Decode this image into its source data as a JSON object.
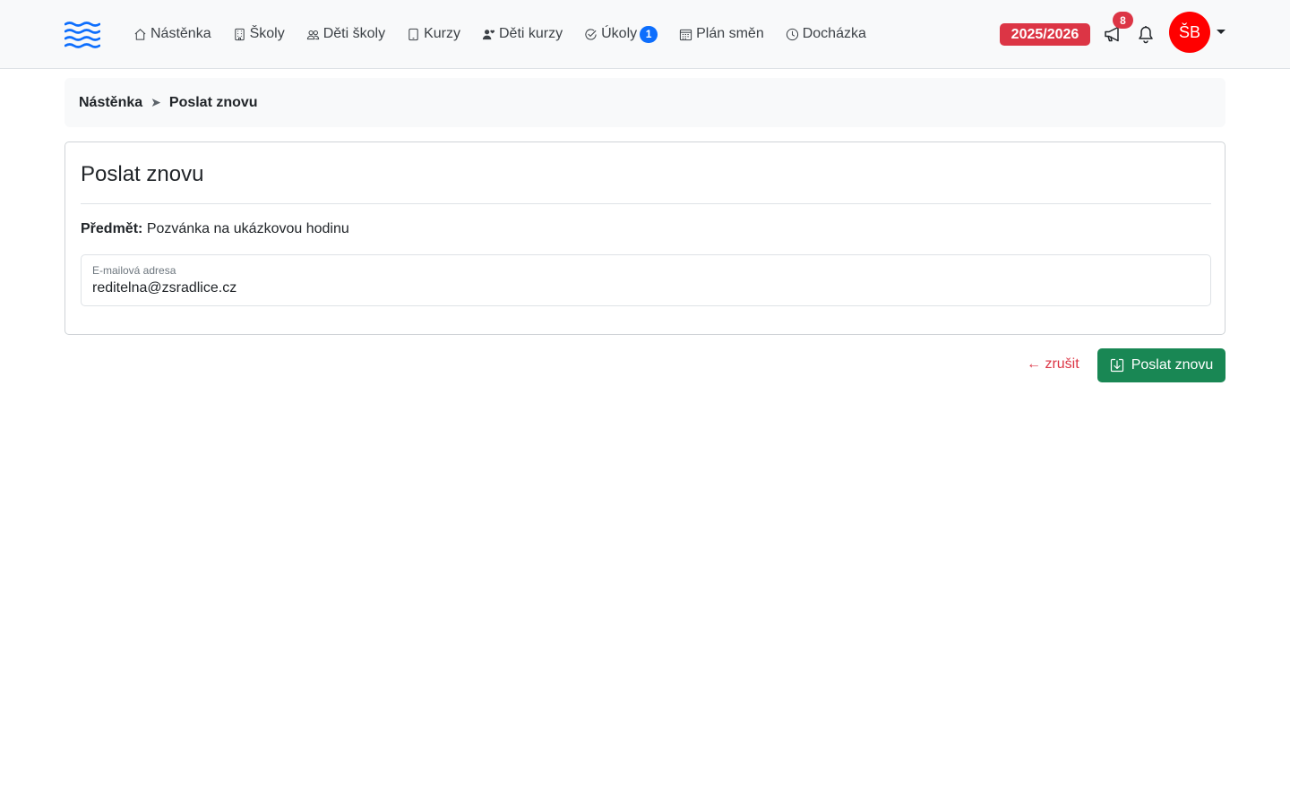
{
  "navbar": {
    "logo_icon": "waves-logo-icon",
    "items": [
      {
        "icon": "house-icon",
        "label": "Nástěnka"
      },
      {
        "icon": "building-icon",
        "label": "Školy"
      },
      {
        "icon": "people-icon",
        "label": "Děti školy"
      },
      {
        "icon": "tablet-icon",
        "label": "Kurzy"
      },
      {
        "icon": "person-heart-icon",
        "label": "Děti kurzy"
      },
      {
        "icon": "check-circle-icon",
        "label": "Úkoly",
        "badge": "1"
      },
      {
        "icon": "calendar-week-icon",
        "label": "Plán směn"
      },
      {
        "icon": "clock-icon",
        "label": "Docházka"
      }
    ],
    "school_year": "2025/2026",
    "announcements_count": "8",
    "user_initials": "ŠB",
    "colors": {
      "year_badge": "#dc3545",
      "avatar": "#ff0000",
      "task_badge": "#0d6efd",
      "logo": "#0d6efd"
    }
  },
  "breadcrumb": {
    "home": "Nástěnka",
    "separator": "➤",
    "current": "Poslat znovu"
  },
  "card": {
    "title": "Poslat znovu",
    "subject_label": "Předmět:",
    "subject_value": "Pozvánka na ukázkovou hodinu",
    "email": {
      "label": "E-mailová adresa",
      "value": "reditelna@zsradlice.cz"
    }
  },
  "actions": {
    "cancel_label": "← zrušit",
    "submit_label": "Poslat znovu",
    "submit_icon": "box-arrow-in-down-icon",
    "submit_color": "#198754",
    "cancel_color": "#dc3545"
  }
}
